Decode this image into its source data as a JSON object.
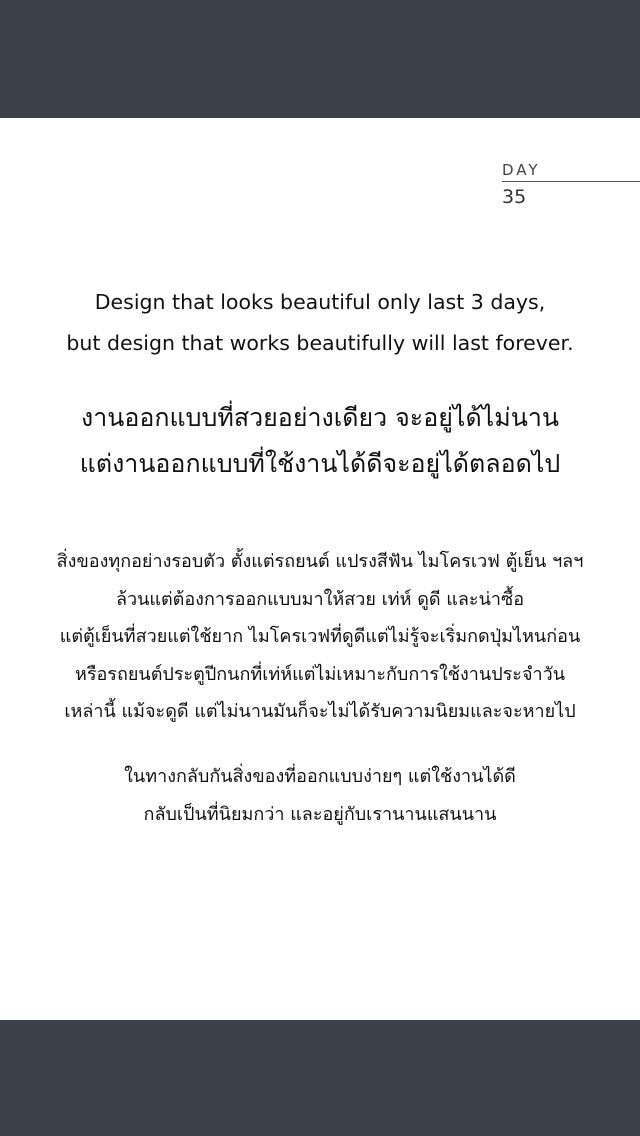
{
  "header": {
    "day_label": "DAY",
    "day_number": "35"
  },
  "quote_en": {
    "lines": [
      "Design that looks beautiful only last 3 days,",
      "but design that works beautifully will last forever."
    ]
  },
  "quote_th": {
    "lines": [
      "งานออกแบบที่สวยอย่างเดียว จะอยู่ได้ไม่นาน",
      "แต่งานออกแบบที่ใช้งานได้ดีจะอยู่ได้ตลอดไป"
    ]
  },
  "paragraph1": {
    "lines": [
      "สิ่งของทุกอย่างรอบตัว ตั้งแต่รถยนต์ แปรงสีฟัน ไมโครเวฟ ตู้เย็น ฯลฯ",
      "ล้วนแต่ต้องการออกแบบมาให้สวย เท่ห์ ดูดี และน่าซื้อ",
      "แต่ตู้เย็นที่สวยแต่ใช้ยาก ไมโครเวฟที่ดูดีแต่ไม่รู้จะเริ่มกดปุ่มไหนก่อน",
      "หรือรถยนต์ประตูปีกนกที่เท่ห์แต่ไม่เหมาะกับการใช้งานประจำวัน",
      "เหล่านี้ แม้จะดูดี แต่ไม่นานมันก็จะไม่ได้รับความนิยมและจะหายไป"
    ]
  },
  "paragraph2": {
    "lines": [
      "ในทางกลับกันสิ่งของที่ออกแบบง่ายๆ แต่ใช้งานได้ดี",
      "กลับเป็นที่นิยมกว่า และอยู่กับเรานานแสนนาน"
    ]
  },
  "colors": {
    "bar": "#3a4149",
    "background": "#ffffff",
    "text": "#111111"
  }
}
